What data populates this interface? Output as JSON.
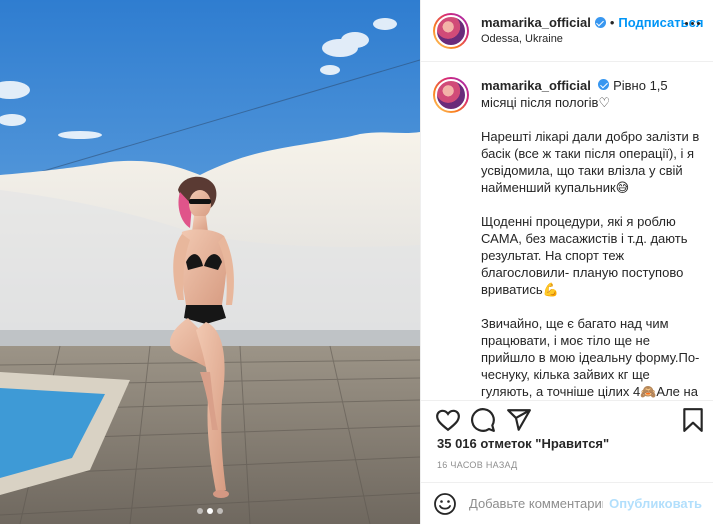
{
  "post": {
    "image": {
      "description_colors": {
        "sky": "#4a8fd4",
        "wall": "#f2f0ec",
        "deck": "#8c8479",
        "pool": "#3e9ad6"
      },
      "carousel_dots": 3,
      "active_dot": 1
    },
    "header": {
      "username": "mamarika_official",
      "separator": "•",
      "follow_label": "Подписаться",
      "location": "Odessa, Ukraine",
      "more_icon": "more-options-icon"
    },
    "caption": {
      "username": "mamarika_official",
      "paragraphs": [
        "Рівно 1,5 місяці після пологів♡",
        "Нарешті лікарі дали добро залізти в басік (все ж таки після операції), і я усвідомила, що таки влізла у свій найменший купальник😅",
        "Щоденні процедури, які я роблю САМА, без масажистів і т.д. дають результат. На спорт теж благословили- планую поступово вриватись💪",
        "Звичайно, ще є багато над чим працювати, і моє тіло ще не прийшло в мою ідеальну форму.По-чеснуку, кілька зайвих кг ще гуляють, а точніше цілих 4🙈Але на даний момент я собою задоволена,"
      ]
    },
    "actions": {
      "icons": [
        "heart-icon",
        "comment-icon",
        "share-icon",
        "bookmark-icon"
      ],
      "likes_text": "35 016 отметок \"Нравится\"",
      "timestamp": "16 часов назад"
    },
    "comment": {
      "placeholder": "Добавьте комментарий...",
      "publish_label": "Опубликовать",
      "emoji_icon": "emoji-icon"
    },
    "colors": {
      "accent": "#0095f6",
      "verified": "#3897f0",
      "publish_disabled": "#b2dffc",
      "text": "#262626",
      "muted": "#8e8e8e"
    }
  }
}
